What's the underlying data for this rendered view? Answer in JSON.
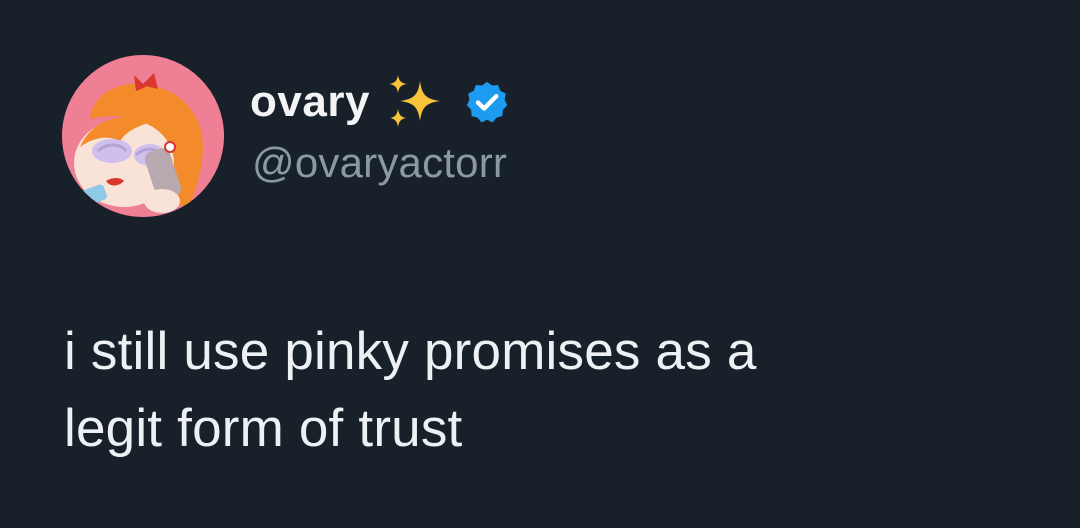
{
  "tweet": {
    "display_name": "ovary",
    "handle": "@ovaryactorr",
    "text_lines": [
      "i still use pinky promises as a",
      "legit form of trust"
    ],
    "avatar_icon": "cartoon-avatar-icon",
    "name_emoji_icon": "sparkles-icon",
    "badge_icon": "verified-badge-icon"
  },
  "colors": {
    "background": "#18202a",
    "verified_badge": "#1d9bf0",
    "avatar_background": "#ee7f95",
    "sparkles": "#f7c33a"
  }
}
